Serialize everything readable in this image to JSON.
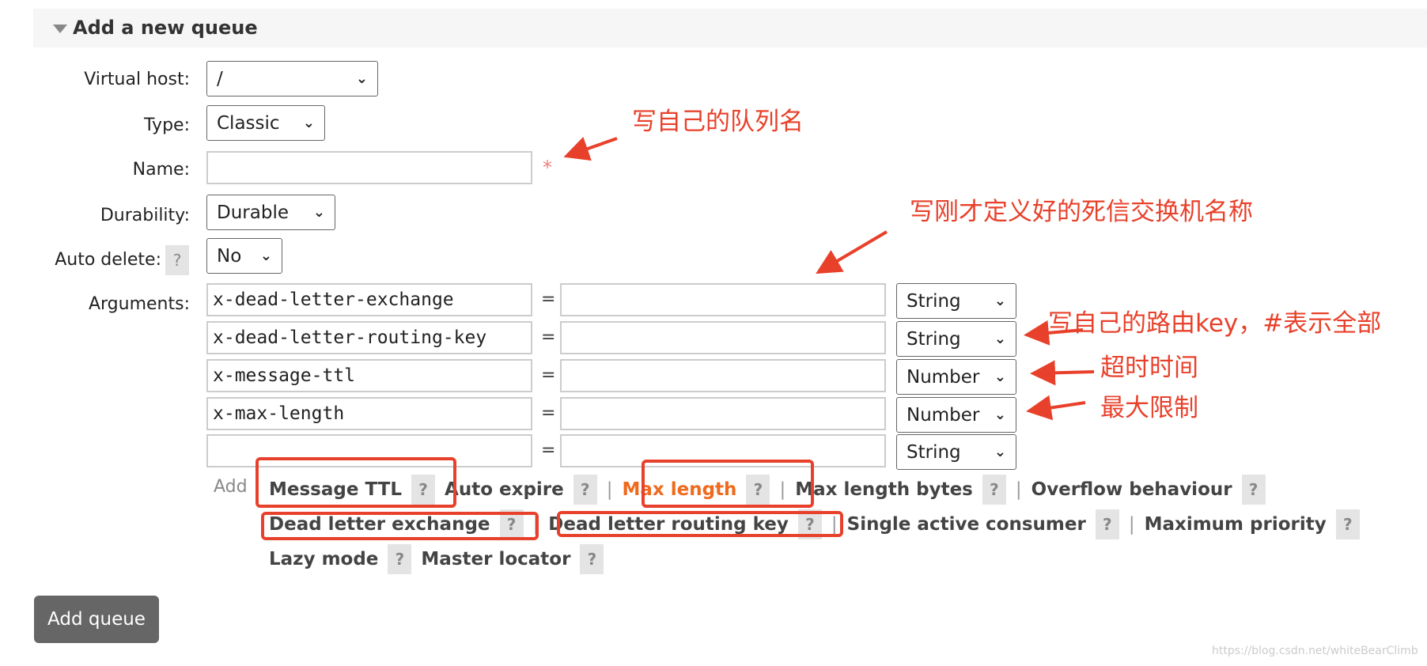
{
  "section": {
    "title": "Add a new queue"
  },
  "form": {
    "virtual_host": {
      "label": "Virtual host:",
      "value": "/"
    },
    "type": {
      "label": "Type:",
      "value": "Classic"
    },
    "name": {
      "label": "Name:",
      "value": "",
      "required_mark": "*"
    },
    "durability": {
      "label": "Durability:",
      "value": "Durable"
    },
    "auto_delete": {
      "label": "Auto delete:",
      "help": "?",
      "value": "No"
    },
    "arguments": {
      "label": "Arguments:",
      "equals": "=",
      "rows": [
        {
          "key": "x-dead-letter-exchange",
          "value": "",
          "type": "String"
        },
        {
          "key": "x-dead-letter-routing-key",
          "value": "",
          "type": "String"
        },
        {
          "key": "x-message-ttl",
          "value": "",
          "type": "Number"
        },
        {
          "key": "x-max-length",
          "value": "",
          "type": "Number"
        },
        {
          "key": "",
          "value": "",
          "type": "String"
        }
      ]
    }
  },
  "add_links": {
    "add_label": "Add",
    "help": "?",
    "sep": "|",
    "items": [
      "Message TTL",
      "Auto expire",
      "Max length",
      "Max length bytes",
      "Overflow behaviour",
      "Dead letter exchange",
      "Dead letter routing key",
      "Single active consumer",
      "Maximum priority",
      "Lazy mode",
      "Master locator"
    ]
  },
  "add_queue_button": "Add queue",
  "annotations": [
    "写自己的队列名",
    "写刚才定义好的死信交换机名称",
    "写自己的路由key，#表示全部",
    "超时时间",
    "最大限制"
  ],
  "annotation_color": "#e8412b",
  "accent_color": "#f06a1e",
  "watermark": "https://blog.csdn.net/whiteBearClimb"
}
